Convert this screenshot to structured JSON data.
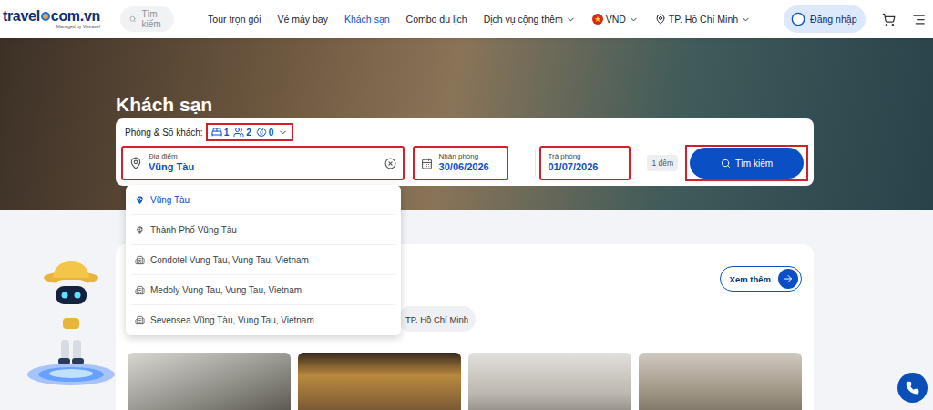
{
  "logo": {
    "left": "travel",
    "right": "com.vn",
    "tagline": "Managed by Vietravel"
  },
  "search": {
    "placeholder": "Tìm kiếm"
  },
  "nav": [
    {
      "label": "Tour trọn gói",
      "selected": false,
      "dropdown": false
    },
    {
      "label": "Vé máy bay",
      "selected": false,
      "dropdown": false
    },
    {
      "label": "Khách sạn",
      "selected": true,
      "dropdown": false
    },
    {
      "label": "Combo du lịch",
      "selected": false,
      "dropdown": false
    },
    {
      "label": "Dịch vụ cộng thêm",
      "selected": false,
      "dropdown": true
    }
  ],
  "currency": "VND",
  "city": "TP. Hồ Chí Minh",
  "login": "Đăng nhập",
  "hero": {
    "title": "Khách sạn"
  },
  "guests": {
    "label": "Phòng & Số khách:",
    "rooms": "1",
    "adults": "2",
    "children": "0",
    "highlighted": true
  },
  "destination": {
    "label": "Địa điểm",
    "value": "Vũng Tàu",
    "highlighted": true
  },
  "dates": [
    {
      "label": "Nhận phòng",
      "value": "30/06/2026",
      "highlighted": true
    },
    {
      "label": "Trả phòng",
      "value": "01/07/2026",
      "highlighted": true
    }
  ],
  "nights": "1 đêm",
  "search_button": {
    "label": "Tìm kiếm",
    "highlighted": true
  },
  "suggestions": [
    {
      "label": "Vũng Tàu",
      "kind": "place",
      "selected": true
    },
    {
      "label": "Thành Phố Vũng Tàu",
      "kind": "place",
      "selected": false
    },
    {
      "label": "Condotel Vung Tau, Vung Tau, Vietnam",
      "kind": "hotel",
      "selected": false
    },
    {
      "label": "Medoly Vung Tau, Vung Tau, Vietnam",
      "kind": "hotel",
      "selected": false
    },
    {
      "label": "Sevensea Vũng Tàu, Vung Tau, Vietnam",
      "kind": "hotel",
      "selected": false
    }
  ],
  "section": {
    "more": "Xem thêm",
    "tabs": [
      {
        "label": "TP. Hồ Chí Minh",
        "selected": false
      }
    ]
  }
}
